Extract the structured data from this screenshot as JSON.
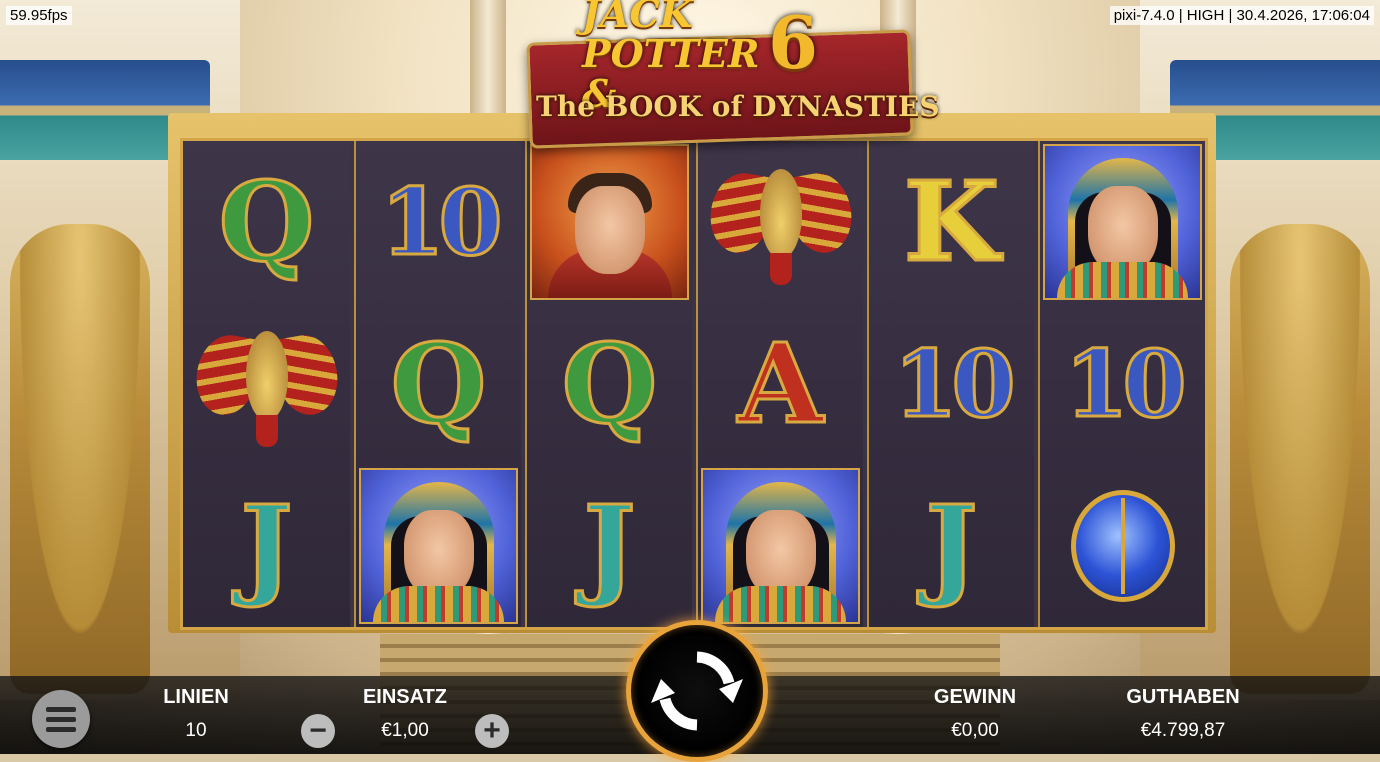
{
  "debug": {
    "fps": "59.95fps",
    "build_info": "pixi-7.4.0 | HIGH | 30.4.2026, 17:06:04"
  },
  "logo": {
    "title_line1": "JACK",
    "title_line2": "POTTER &",
    "number": "6",
    "subtitle": "The BOOK of DYNASTIES"
  },
  "reels": [
    [
      "Q",
      "scarab",
      "J"
    ],
    [
      "10",
      "Q",
      "queen"
    ],
    [
      "hero",
      "Q",
      "J"
    ],
    [
      "scarab",
      "A",
      "queen"
    ],
    [
      "K",
      "10",
      "J"
    ],
    [
      "queen",
      "10",
      "blue-scarab"
    ]
  ],
  "symbol_colors": {
    "Q": "#3f9a3f",
    "10": "#3b58c0",
    "J": "#35a79a",
    "K": "#e7cf3b",
    "A": "#c0301f"
  },
  "controls": {
    "lines_label": "LINIEN",
    "lines_value": "10",
    "bet_label": "EINSATZ",
    "bet_value": "€1,00",
    "win_label": "GEWINN",
    "win_value": "€0,00",
    "balance_label": "GUTHABEN",
    "balance_value": "€4.799,87",
    "minus": "−",
    "plus": "+"
  }
}
